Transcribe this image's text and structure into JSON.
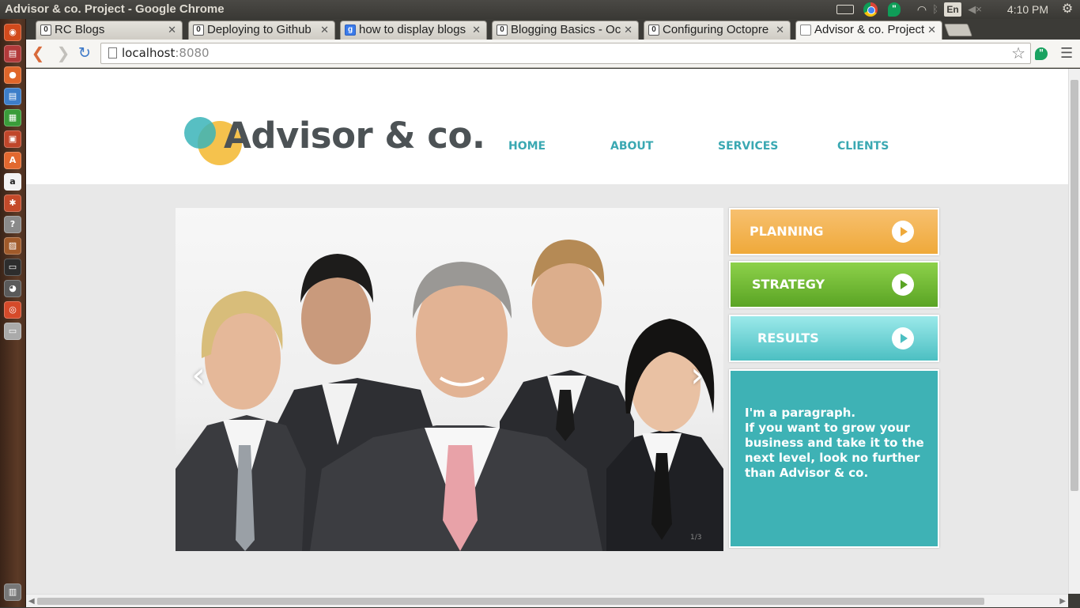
{
  "os": {
    "window_title": "Advisor & co. Project - Google Chrome",
    "language": "En",
    "clock": "4:10 PM"
  },
  "browser": {
    "tabs": [
      {
        "label": "RC Blogs",
        "favicon": "octopress-icon"
      },
      {
        "label": "Deploying to Github",
        "favicon": "octopress-icon"
      },
      {
        "label": "how to display blogs",
        "favicon": "google-icon"
      },
      {
        "label": "Blogging Basics - Oc",
        "favicon": "octopress-icon"
      },
      {
        "label": "Configuring Octopre",
        "favicon": "octopress-icon"
      },
      {
        "label": "Advisor & co. Project",
        "favicon": "page-icon"
      }
    ],
    "address": {
      "host": "localhost",
      "port": ":8080"
    }
  },
  "site": {
    "logo_text": "Advisor & co.",
    "nav": [
      "HOME",
      "ABOUT",
      "SERVICES",
      "CLIENTS"
    ],
    "slider": {
      "counter": "1/3",
      "prev_glyph": "‹",
      "next_glyph": "›"
    },
    "side_buttons": [
      "PLANNING",
      "STRATEGY",
      "RESULTS"
    ],
    "paragraph_title": "I'm a paragraph.",
    "paragraph_body": "If you want to grow your business and take it to the next level, look no further than Advisor & co."
  },
  "colors": {
    "accent": "#3aa8b2",
    "planning": "#efa93a",
    "strategy": "#5aa424",
    "results": "#4cbfc2",
    "info_box": "#3eb2b5"
  }
}
